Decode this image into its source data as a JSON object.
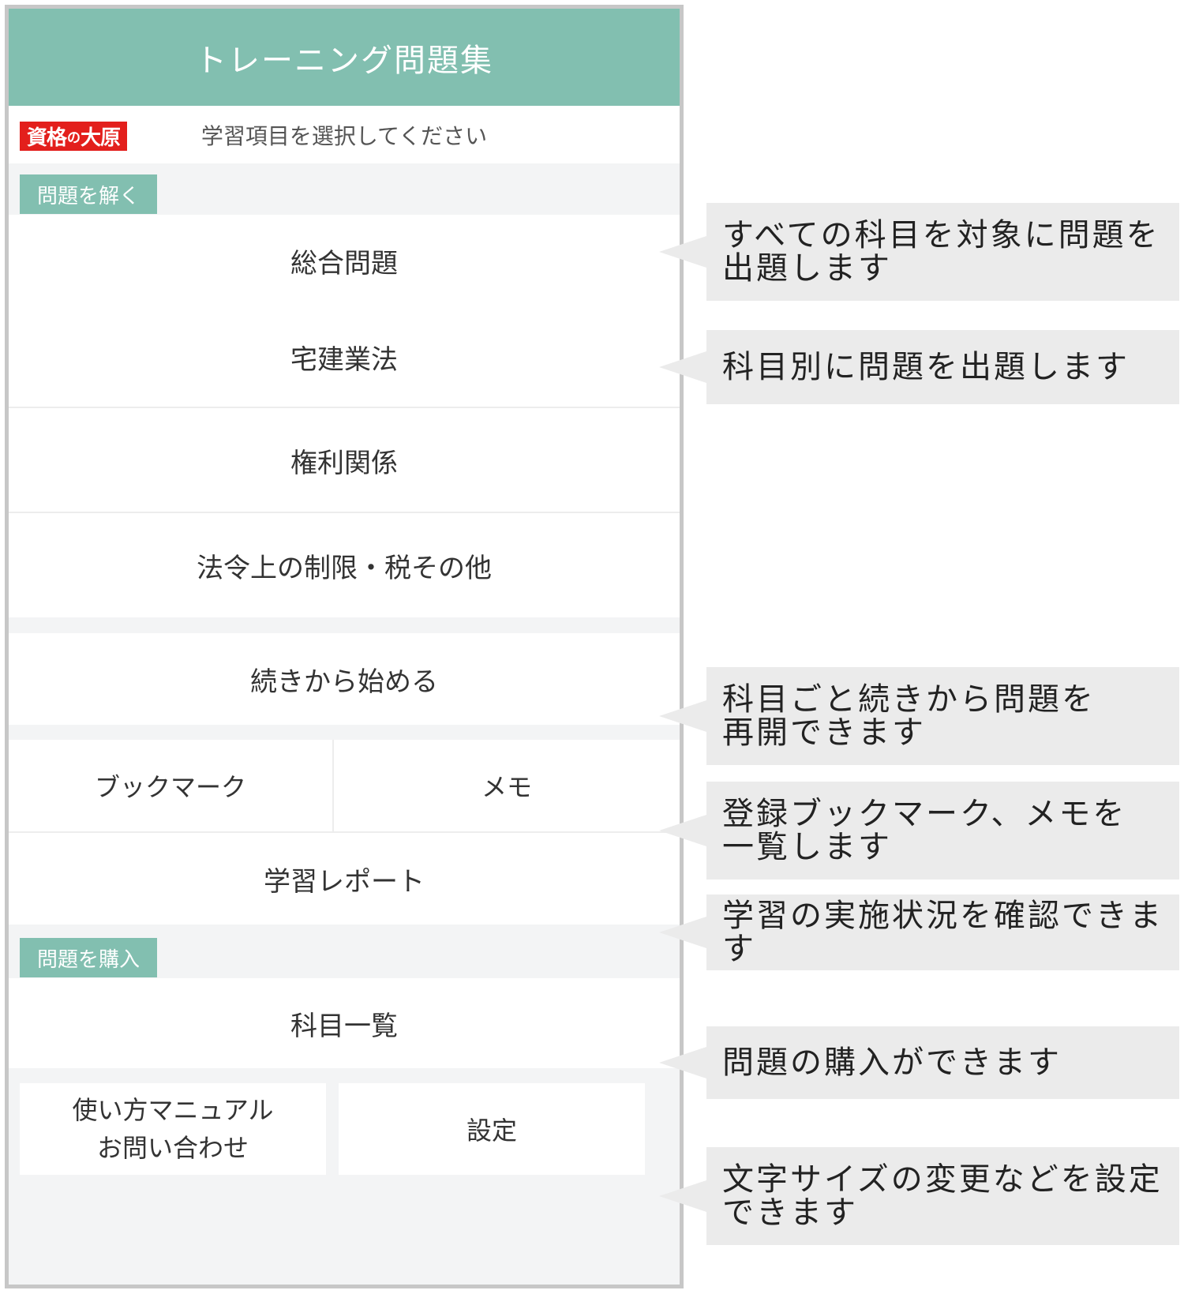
{
  "app": {
    "title": "トレーニング問題集",
    "logo_text_1": "資格",
    "logo_text_2": "の",
    "logo_text_3": "大原",
    "subtitle": "学習項目を選択してください"
  },
  "sections": {
    "solve_label": "問題を解く",
    "purchase_label": "問題を購入"
  },
  "menu": {
    "comprehensive": "総合問題",
    "takken": "宅建業法",
    "rights": "権利関係",
    "law_limits": "法令上の制限・税その他",
    "continue": "続きから始める",
    "bookmark": "ブックマーク",
    "memo": "メモ",
    "report": "学習レポート",
    "subjects": "科目一覧",
    "manual_line1": "使い方マニュアル",
    "manual_line2": "お問い合わせ",
    "settings": "設定"
  },
  "callouts": {
    "all_subjects": "すべての科目を対象に問題を\n出題します",
    "by_subject": "科目別に問題を出題します",
    "resume": "科目ごと続きから問題を\n再開できます",
    "bookmarks": "登録ブックマーク、メモを\n一覧します",
    "report": "学習の実施状況を確認できます",
    "purchase": "問題の購入ができます",
    "settings": "文字サイズの変更などを設定\nできます"
  },
  "colors": {
    "accent": "#82bfb0",
    "logo_red": "#e31f1c",
    "callout_bg": "#ebebeb",
    "frame": "#c7c7c7"
  }
}
